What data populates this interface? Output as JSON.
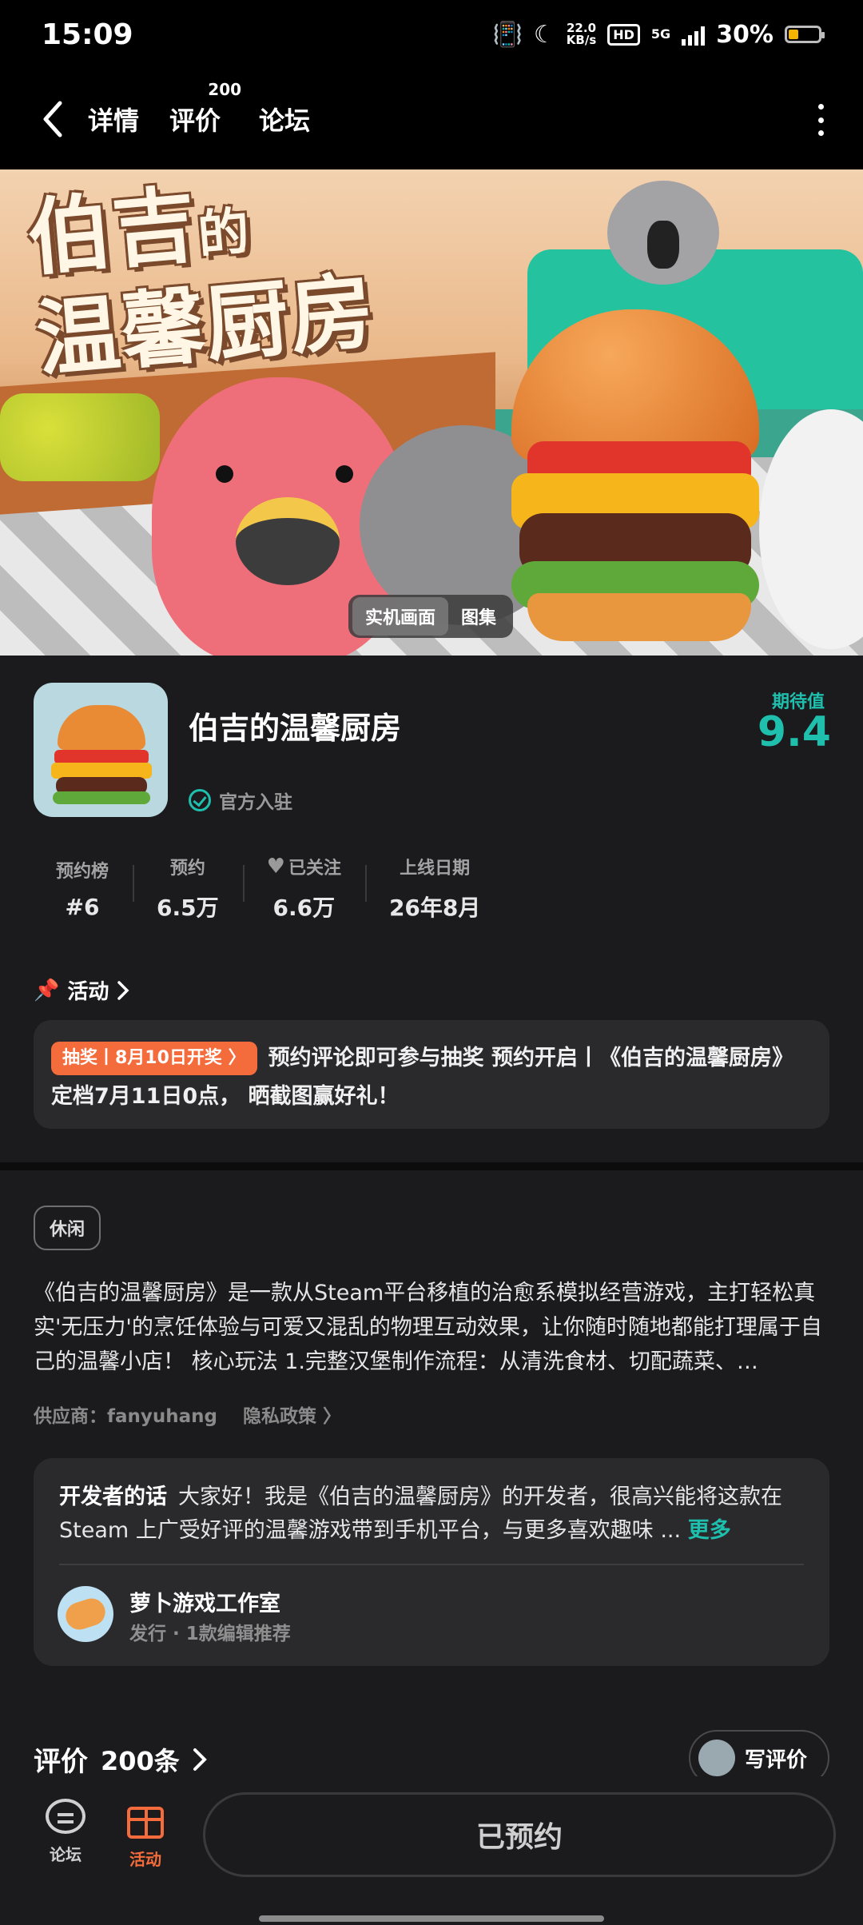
{
  "status": {
    "time": "15:09",
    "net_speed": "22.0",
    "net_unit": "KB/s",
    "hd": "HD",
    "signal": "5G",
    "battery": "30%"
  },
  "nav": {
    "tabs": [
      {
        "label": "详情"
      },
      {
        "label": "评价",
        "badge": "200"
      },
      {
        "label": "论坛"
      }
    ]
  },
  "banner": {
    "art_line1": "伯吉",
    "art_line1_small": "的",
    "art_line2": "温馨厨房",
    "tabs": [
      "实机画面",
      "图集"
    ]
  },
  "game": {
    "name": "伯吉的温馨厨房",
    "official": "官方入驻",
    "expect_label": "期待值",
    "expect_value": "9.4"
  },
  "stats": [
    {
      "label": "预约榜",
      "value": "#6"
    },
    {
      "label": "预约",
      "value": "6.5万"
    },
    {
      "label": "已关注",
      "value": "6.6万"
    },
    {
      "label": "上线日期",
      "value": "26年8月"
    }
  ],
  "activity": {
    "title": "活动",
    "tag": "抽奖丨8月10日开奖 〉",
    "text": "预约评论即可参与抽奖 预约开启丨《伯吉的温馨厨房》定档7月11日0点， 晒截图赢好礼！"
  },
  "genre": "休闲",
  "description": "《伯吉的温馨厨房》是一款从Steam平台移植的治愈系模拟经营游戏，主打轻松真实'无压力'的烹饪体验与可爱又混乱的物理互动效果，让你随时随地都能打理属于自己的温馨小店！ 核心玩法 1.完整汉堡制作流程：从清洗食材、切配蔬菜、…",
  "supplier": {
    "label": "供应商：fanyuhang",
    "privacy": "隐私政策 〉"
  },
  "developer": {
    "lead": "开发者的话",
    "text": "大家好！我是《伯吉的温馨厨房》的开发者，很高兴能将这款在 Steam 上广受好评的温馨游戏带到手机平台，与更多喜欢趣味 ...",
    "more": "更多",
    "name": "萝卜游戏工作室",
    "sub": "发行 · 1款编辑推荐"
  },
  "reviews": {
    "title": "评价",
    "count": "200条",
    "write": "写评价"
  },
  "bottom": {
    "forum": "论坛",
    "activity": "活动",
    "reserved": "已预约"
  },
  "colors": {
    "accent": "#1fbfae",
    "orange": "#f46b3c",
    "bg": "#1b1b1d"
  }
}
